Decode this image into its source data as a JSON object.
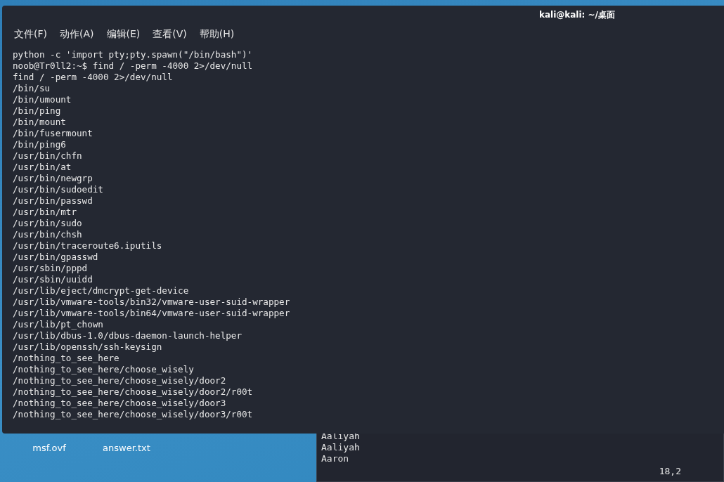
{
  "desktop_icons": [
    {
      "label": "msf.ovf"
    },
    {
      "label": "answer.txt"
    }
  ],
  "back_terminal": {
    "lines": [
      "Aaliyah",
      "Aaliyah",
      "Aaron"
    ],
    "status": "18,2"
  },
  "terminal": {
    "title": "kali@kali: ~/桌面",
    "menu": [
      "文件(F)",
      "动作(A)",
      "编辑(E)",
      "查看(V)",
      "帮助(H)"
    ],
    "lines": [
      "python -c 'import pty;pty.spawn(\"/bin/bash\")'",
      "noob@Tr0ll2:~$ find / -perm -4000 2>/dev/null",
      "find / -perm -4000 2>/dev/null",
      "/bin/su",
      "/bin/umount",
      "/bin/ping",
      "/bin/mount",
      "/bin/fusermount",
      "/bin/ping6",
      "/usr/bin/chfn",
      "/usr/bin/at",
      "/usr/bin/newgrp",
      "/usr/bin/sudoedit",
      "/usr/bin/passwd",
      "/usr/bin/mtr",
      "/usr/bin/sudo",
      "/usr/bin/chsh",
      "/usr/bin/traceroute6.iputils",
      "/usr/bin/gpasswd",
      "/usr/sbin/pppd",
      "/usr/sbin/uuidd",
      "/usr/lib/eject/dmcrypt-get-device",
      "/usr/lib/vmware-tools/bin32/vmware-user-suid-wrapper",
      "/usr/lib/vmware-tools/bin64/vmware-user-suid-wrapper",
      "/usr/lib/pt_chown",
      "/usr/lib/dbus-1.0/dbus-daemon-launch-helper",
      "/usr/lib/openssh/ssh-keysign",
      "/nothing_to_see_here",
      "/nothing_to_see_here/choose_wisely",
      "/nothing_to_see_here/choose_wisely/door2",
      "/nothing_to_see_here/choose_wisely/door2/r00t",
      "/nothing_to_see_here/choose_wisely/door3",
      "/nothing_to_see_here/choose_wisely/door3/r00t"
    ]
  }
}
